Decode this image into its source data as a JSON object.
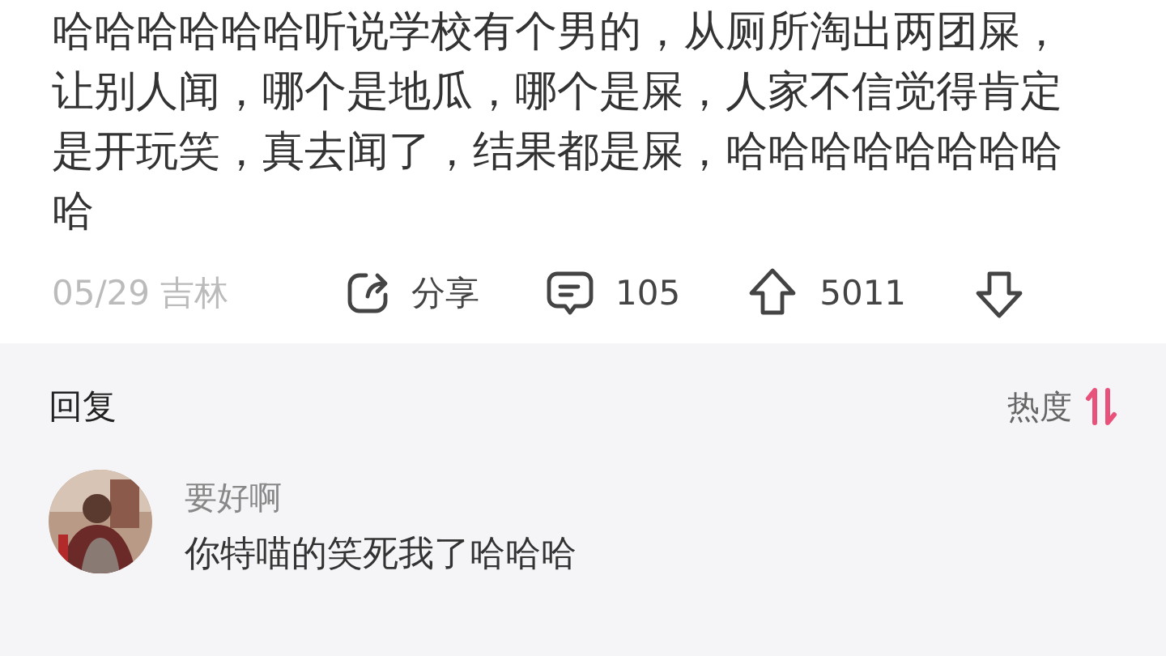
{
  "post": {
    "text": "哈哈哈哈哈哈听说学校有个男的，从厕所淘出两团屎，让别人闻，哪个是地瓜，哪个是屎，人家不信觉得肯定是开玩笑，真去闻了，结果都是屎，哈哈哈哈哈哈哈哈哈",
    "meta": "05/29 吉林",
    "share": "分享",
    "comments": "105",
    "upvotes": "5011"
  },
  "replies_header": {
    "title": "回复",
    "sort": "热度"
  },
  "replies": [
    {
      "kind": "picture",
      "name": "要好啊",
      "text": "你特喵的笑死我了哈哈哈"
    }
  ]
}
